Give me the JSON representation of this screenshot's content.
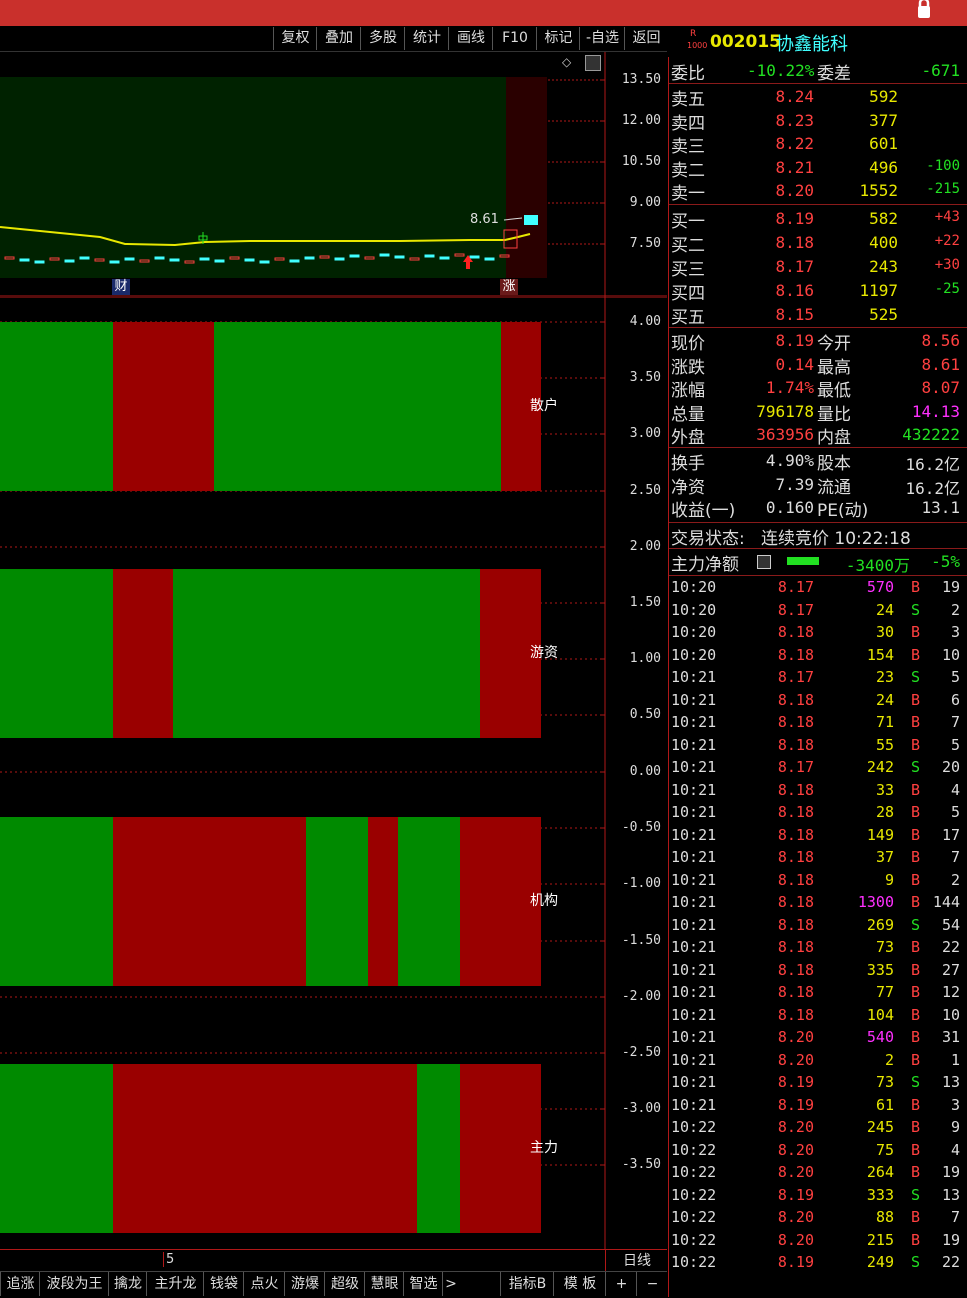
{
  "toolbar": [
    "复权",
    "叠加",
    "多股",
    "统计",
    "画线",
    "F10",
    "标记",
    "-自选",
    "返回"
  ],
  "main_chart": {
    "y_ticks": [
      "13.50",
      "12.00",
      "10.50",
      "9.00",
      "7.50"
    ],
    "high_label": "8.61",
    "markers": [
      "财",
      "涨"
    ]
  },
  "indicator": {
    "y_ticks": [
      "4.00",
      "3.50",
      "3.00",
      "2.50",
      "2.00",
      "1.50",
      "1.00",
      "0.50",
      "0.00",
      "-0.50",
      "-1.00",
      "-1.50",
      "-2.00",
      "-2.50",
      "-3.00",
      "-3.50"
    ],
    "bands": [
      {
        "label": "散户",
        "segments": [
          [
            "g",
            113
          ],
          [
            "r",
            101
          ],
          [
            "g",
            287
          ],
          [
            "r",
            40
          ]
        ]
      },
      {
        "label": "游资",
        "segments": [
          [
            "g",
            113
          ],
          [
            "r",
            60
          ],
          [
            "g",
            307
          ],
          [
            "r",
            61
          ]
        ]
      },
      {
        "label": "机构",
        "segments": [
          [
            "g",
            113
          ],
          [
            "r",
            193
          ],
          [
            "g",
            62
          ],
          [
            "r",
            30
          ],
          [
            "g",
            62
          ],
          [
            "r",
            81
          ]
        ]
      },
      {
        "label": "主力",
        "segments": [
          [
            "g",
            113
          ],
          [
            "r",
            304
          ],
          [
            "g",
            43
          ],
          [
            "r",
            81
          ]
        ]
      }
    ],
    "x_label": "5",
    "period": "日线"
  },
  "bottom_tabs": [
    "追涨",
    "波段为王",
    "擒龙",
    "主升龙",
    "钱袋",
    "点火",
    "游爆",
    "超级",
    "慧眼",
    "智选",
    ">"
  ],
  "bottom_right": [
    "指标B",
    "模 板",
    "+",
    "−"
  ],
  "stock": {
    "flag_top": "R",
    "flag_bottom": "1000",
    "code": "002015",
    "name": "协鑫能科"
  },
  "weibi": {
    "label": "委比",
    "value": "-10.22%",
    "label2": "委差",
    "value2": "-671"
  },
  "asks": [
    {
      "label": "卖五",
      "price": "8.24",
      "vol": "592",
      "chg": ""
    },
    {
      "label": "卖四",
      "price": "8.23",
      "vol": "377",
      "chg": ""
    },
    {
      "label": "卖三",
      "price": "8.22",
      "vol": "601",
      "chg": ""
    },
    {
      "label": "卖二",
      "price": "8.21",
      "vol": "496",
      "chg": "-100"
    },
    {
      "label": "卖一",
      "price": "8.20",
      "vol": "1552",
      "chg": "-215"
    }
  ],
  "bids": [
    {
      "label": "买一",
      "price": "8.19",
      "vol": "582",
      "chg": "+43"
    },
    {
      "label": "买二",
      "price": "8.18",
      "vol": "400",
      "chg": "+22"
    },
    {
      "label": "买三",
      "price": "8.17",
      "vol": "243",
      "chg": "+30"
    },
    {
      "label": "买四",
      "price": "8.16",
      "vol": "1197",
      "chg": "-25"
    },
    {
      "label": "买五",
      "price": "8.15",
      "vol": "525",
      "chg": ""
    }
  ],
  "quote": [
    {
      "l1": "现价",
      "v1": "8.19",
      "c1": "r",
      "l2": "今开",
      "v2": "8.56",
      "c2": "r"
    },
    {
      "l1": "涨跌",
      "v1": "0.14",
      "c1": "r",
      "l2": "最高",
      "v2": "8.61",
      "c2": "r"
    },
    {
      "l1": "涨幅",
      "v1": "1.74%",
      "c1": "r",
      "l2": "最低",
      "v2": "8.07",
      "c2": "r"
    },
    {
      "l1": "总量",
      "v1": "796178",
      "c1": "y",
      "l2": "量比",
      "v2": "14.13",
      "c2": "m"
    },
    {
      "l1": "外盘",
      "v1": "363956",
      "c1": "r",
      "l2": "内盘",
      "v2": "432222",
      "c2": "g"
    }
  ],
  "fund": [
    {
      "l1": "换手",
      "v1": "4.90%",
      "l2": "股本",
      "v2": "16.2亿"
    },
    {
      "l1": "净资",
      "v1": "7.39",
      "l2": "流通",
      "v2": "16.2亿"
    },
    {
      "l1": "收益(一)",
      "v1": "0.160",
      "l2": "PE(动)",
      "v2": "13.1"
    }
  ],
  "status": {
    "label": "交易状态:",
    "value": "连续竞价 10:22:18"
  },
  "mainflow": {
    "label": "主力净额",
    "value": "-3400万",
    "pct": "-5%"
  },
  "ticks": [
    [
      "10:20",
      "8.17",
      "570",
      "B",
      "19",
      "m"
    ],
    [
      "10:20",
      "8.17",
      "24",
      "S",
      "2",
      "y"
    ],
    [
      "10:20",
      "8.18",
      "30",
      "B",
      "3",
      "y"
    ],
    [
      "10:20",
      "8.18",
      "154",
      "B",
      "10",
      "y"
    ],
    [
      "10:21",
      "8.17",
      "23",
      "S",
      "5",
      "y"
    ],
    [
      "10:21",
      "8.18",
      "24",
      "B",
      "6",
      "y"
    ],
    [
      "10:21",
      "8.18",
      "71",
      "B",
      "7",
      "y"
    ],
    [
      "10:21",
      "8.18",
      "55",
      "B",
      "5",
      "y"
    ],
    [
      "10:21",
      "8.17",
      "242",
      "S",
      "20",
      "y"
    ],
    [
      "10:21",
      "8.18",
      "33",
      "B",
      "4",
      "y"
    ],
    [
      "10:21",
      "8.18",
      "28",
      "B",
      "5",
      "y"
    ],
    [
      "10:21",
      "8.18",
      "149",
      "B",
      "17",
      "y"
    ],
    [
      "10:21",
      "8.18",
      "37",
      "B",
      "7",
      "y"
    ],
    [
      "10:21",
      "8.18",
      "9",
      "B",
      "2",
      "y"
    ],
    [
      "10:21",
      "8.18",
      "1300",
      "B",
      "144",
      "m"
    ],
    [
      "10:21",
      "8.18",
      "269",
      "S",
      "54",
      "y"
    ],
    [
      "10:21",
      "8.18",
      "73",
      "B",
      "22",
      "y"
    ],
    [
      "10:21",
      "8.18",
      "335",
      "B",
      "27",
      "y"
    ],
    [
      "10:21",
      "8.18",
      "77",
      "B",
      "12",
      "y"
    ],
    [
      "10:21",
      "8.18",
      "104",
      "B",
      "10",
      "y"
    ],
    [
      "10:21",
      "8.20",
      "540",
      "B",
      "31",
      "m"
    ],
    [
      "10:21",
      "8.20",
      "2",
      "B",
      "1",
      "y"
    ],
    [
      "10:21",
      "8.19",
      "73",
      "S",
      "13",
      "y"
    ],
    [
      "10:21",
      "8.19",
      "61",
      "B",
      "3",
      "y"
    ],
    [
      "10:22",
      "8.20",
      "245",
      "B",
      "9",
      "y"
    ],
    [
      "10:22",
      "8.20",
      "75",
      "B",
      "4",
      "y"
    ],
    [
      "10:22",
      "8.20",
      "264",
      "B",
      "19",
      "y"
    ],
    [
      "10:22",
      "8.19",
      "333",
      "S",
      "13",
      "y"
    ],
    [
      "10:22",
      "8.20",
      "88",
      "B",
      "7",
      "y"
    ],
    [
      "10:22",
      "8.20",
      "215",
      "B",
      "19",
      "y"
    ],
    [
      "10:22",
      "8.19",
      "249",
      "S",
      "22",
      "y"
    ]
  ],
  "colors": {
    "red": "#ff4040",
    "green": "#22e022",
    "band_red": "#9a0000",
    "band_green": "#008a00",
    "frame": "#b01818"
  }
}
